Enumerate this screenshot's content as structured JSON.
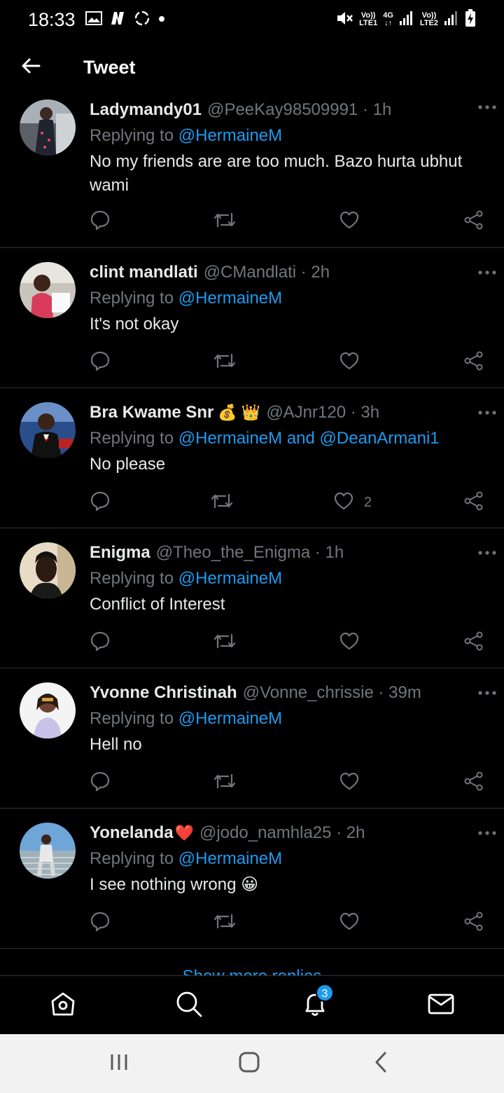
{
  "status": {
    "time": "18:33",
    "sim1_top": "Vo))",
    "sim1_bottom": "LTE1",
    "net_type": "4G",
    "sim2_top": "Vo))",
    "sim2_bottom": "LTE2"
  },
  "header": {
    "title": "Tweet"
  },
  "tweets": [
    {
      "name": "Ladymandy01",
      "handle": "@PeeKay98509991 · 1h",
      "reply_prefix": "Replying to ",
      "mention1": "@HermaineM",
      "text": "No my friends are are too much. Bazo hurta ubhut wami"
    },
    {
      "name": "clint mandlati",
      "handle": "@CMandlati · 2h",
      "reply_prefix": "Replying to ",
      "mention1": "@HermaineM",
      "text": "It's not okay"
    },
    {
      "name": "Bra Kwame Snr",
      "emoji": "💰 👑",
      "handle": "@AJnr120 · 3h",
      "reply_prefix": "Replying to ",
      "mention1": "@HermaineM",
      "joiner": " and ",
      "mention2": "@DeanArmani1",
      "text": "No please",
      "like_count": "2"
    },
    {
      "name": "Enigma",
      "handle": "@Theo_the_Enigma · 1h",
      "reply_prefix": "Replying to ",
      "mention1": "@HermaineM",
      "text": "Conflict of Interest"
    },
    {
      "name": "Yvonne Christinah",
      "handle": "@Vonne_chrissie · 39m",
      "reply_prefix": "Replying to ",
      "mention1": "@HermaineM",
      "text": "Hell no"
    },
    {
      "name": "Yonelanda",
      "emoji": "❤️",
      "handle": "@jodo_namhla25 · 2h",
      "reply_prefix": "Replying to ",
      "mention1": "@HermaineM",
      "text": "I see nothing wrong 😀"
    }
  ],
  "show_more": "Show more replies",
  "nav": {
    "notification_badge": "3"
  },
  "colors": {
    "accent": "#1d9bf0",
    "muted": "#71767b",
    "background": "#000000",
    "divider": "#2f3336"
  }
}
